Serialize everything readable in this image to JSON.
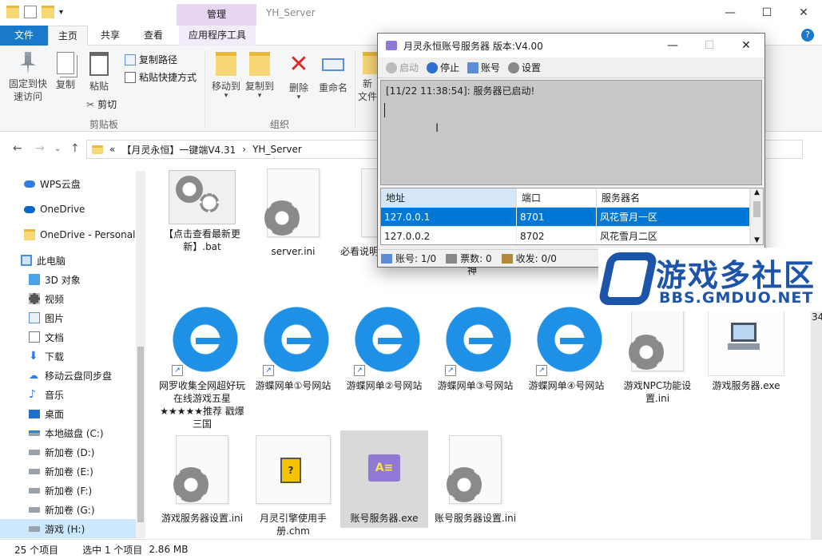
{
  "explorer": {
    "title": "YH_Server",
    "manage_tab": "管理",
    "window_buttons": {
      "minimize": "—",
      "maximize": "☐",
      "close": "✕"
    },
    "tabs": {
      "file": "文件",
      "home": "主页",
      "share": "共享",
      "view": "查看",
      "apptools": "应用程序工具"
    },
    "ribbon": {
      "pin": "固定到快\n速访问",
      "copy": "复制",
      "paste": "粘贴",
      "copy_path": "复制路径",
      "paste_shortcut": "粘贴快捷方式",
      "cut": "剪切",
      "clipboard_group": "剪贴板",
      "move_to": "移动到",
      "copy_to": "复制到",
      "delete": "删除",
      "rename": "重命名",
      "new_folder": "新\n文件",
      "organize_group": "组织"
    },
    "address": {
      "chevron": "«",
      "crumb1": "【月灵永恒】一键端V4.31",
      "sep": "›",
      "crumb2": "YH_Server"
    },
    "nav": [
      {
        "label": "WPS云盘",
        "icon": "cloud-icon"
      },
      {
        "label": "OneDrive",
        "icon": "cloud-icon"
      },
      {
        "label": "OneDrive - Personal",
        "icon": "folder-icon"
      },
      {
        "label": "此电脑",
        "icon": "computer-icon"
      },
      {
        "label": "3D 对象",
        "icon": "cube-icon"
      },
      {
        "label": "视频",
        "icon": "video-icon"
      },
      {
        "label": "图片",
        "icon": "picture-icon"
      },
      {
        "label": "文档",
        "icon": "document-icon"
      },
      {
        "label": "下载",
        "icon": "download-icon"
      },
      {
        "label": "移动云盘同步盘",
        "icon": "sync-icon"
      },
      {
        "label": "音乐",
        "icon": "music-icon"
      },
      {
        "label": "桌面",
        "icon": "desktop-icon"
      },
      {
        "label": "本地磁盘 (C:)",
        "icon": "drive-icon"
      },
      {
        "label": "新加卷 (D:)",
        "icon": "drive-icon"
      },
      {
        "label": "新加卷 (E:)",
        "icon": "drive-icon"
      },
      {
        "label": "新加卷 (F:)",
        "icon": "drive-icon"
      },
      {
        "label": "新加卷 (G:)",
        "icon": "drive-icon"
      },
      {
        "label": "游戏 (H:)",
        "icon": "drive-icon"
      }
    ],
    "files": [
      {
        "name": "【点击查看最新更新】.bat",
        "kind": "bat"
      },
      {
        "name": "server.ini",
        "kind": "ini"
      },
      {
        "name": "必看说明",
        "kind": "doc"
      },
      {
        "name": "士，被命运选择的战神",
        "kind": "partial"
      },
      {
        "name": "网罗收集全网超好玩在线游戏五星★★★★★推荐 戳爆三国",
        "kind": "ie"
      },
      {
        "name": "游蝶网单①号网站",
        "kind": "ie"
      },
      {
        "name": "游蝶网单②号网站",
        "kind": "ie"
      },
      {
        "name": "游蝶网单③号网站",
        "kind": "ie"
      },
      {
        "name": "游蝶网单④号网站",
        "kind": "ie"
      },
      {
        "name": "游戏NPC功能设置.ini",
        "kind": "ini"
      },
      {
        "name": "游戏服务器.exe",
        "kind": "exe"
      },
      {
        "name": "游戏服务器设置.ini",
        "kind": "ini"
      },
      {
        "name": "月灵引擎使用手册.chm",
        "kind": "chm"
      },
      {
        "name": "账号服务器.exe",
        "kind": "exe-selected"
      },
      {
        "name": "账号服务器设置.ini",
        "kind": "ini"
      }
    ],
    "status": {
      "count": "25 个项目",
      "selected": "选中 1 个项目",
      "size": "2.86 MB"
    }
  },
  "dialog": {
    "title": "月灵永恒账号服务器 版本:V4.00",
    "toolbar": {
      "start": "启动",
      "stop": "停止",
      "account": "账号",
      "settings": "设置"
    },
    "log": "[11/22 11:38:54]: 服务器已启动!",
    "table": {
      "headers": [
        "地址",
        "端口",
        "服务器名"
      ],
      "rows": [
        {
          "addr": "127.0.0.1",
          "port": "8701",
          "name": "风花雪月一区"
        },
        {
          "addr": "127.0.0.2",
          "port": "8702",
          "name": "风花雪月二区"
        }
      ]
    },
    "status": {
      "accounts": "账号: 1/0",
      "tickets": "票数: 0",
      "recv": "收发: 0/0"
    }
  },
  "watermark": {
    "title": "游戏多社区",
    "subtitle": "BBS.GMDUO.NET"
  },
  "right_edge": {
    "text": "34"
  },
  "colors": {
    "accent": "#1979ca",
    "selection": "#0078d7",
    "watermark": "#1b54a8"
  }
}
